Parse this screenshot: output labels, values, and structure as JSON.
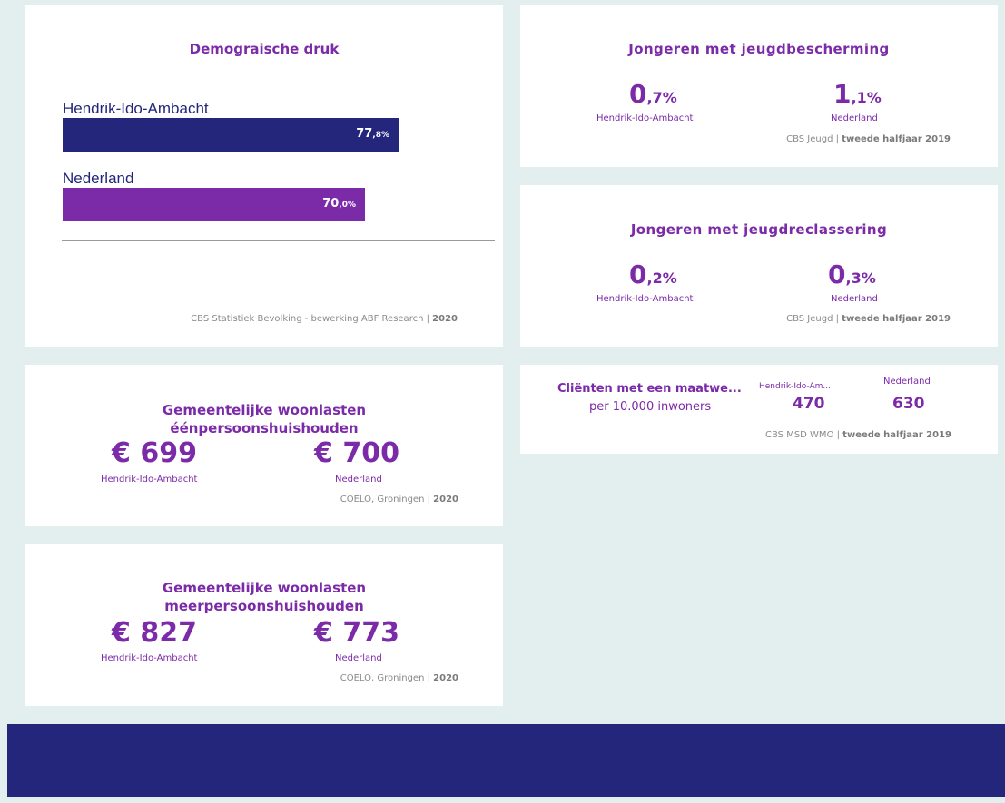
{
  "demografie": {
    "title": "Demograische druk",
    "source": "CBS Statistiek Bevolking - bewerking ABF Research",
    "source_year": "2020",
    "chart_data": {
      "type": "bar",
      "orientation": "horizontal",
      "categories": [
        "Hendrik-Ido-Ambacht",
        "Nederland"
      ],
      "values": [
        77.8,
        70.0
      ],
      "value_labels": [
        {
          "int": "77",
          "dec": ",8%"
        },
        {
          "int": "70",
          "dec": ",0%"
        }
      ],
      "colors": [
        "#23267a",
        "#7b2aa8"
      ],
      "xlim": [
        0,
        100
      ],
      "grid": false
    }
  },
  "jeugdbescherming": {
    "title": "Jongeren met jeugdbescherming",
    "a_int": "0",
    "a_dec": ",7%",
    "a_label": "Hendrik-Ido-Ambacht",
    "b_int": "1",
    "b_dec": ",1%",
    "b_label": "Nederland",
    "source": "CBS Jeugd",
    "source_period": "tweede halfjaar 2019"
  },
  "jeugdreclassering": {
    "title": "Jongeren met jeugdreclassering",
    "a_int": "0",
    "a_dec": ",2%",
    "a_label": "Hendrik-Ido-Ambacht",
    "b_int": "0",
    "b_dec": ",3%",
    "b_label": "Nederland",
    "source": "CBS Jeugd",
    "source_period": "tweede halfjaar 2019"
  },
  "maatwerk": {
    "title": "Cliënten met een maatwe...",
    "subtitle": "per 10.000 inwoners",
    "a_label": "Hendrik-Ido-Am...",
    "a_value": "470",
    "b_label": "Nederland",
    "b_value": "630",
    "source": "CBS MSD WMO",
    "source_period": "tweede halfjaar 2019"
  },
  "woonlasten_een": {
    "title_line1": "Gemeentelijke woonlasten",
    "title_line2": "éénpersoonshuishouden",
    "a_value": "€ 699",
    "a_label": "Hendrik-Ido-Ambacht",
    "b_value": "€ 700",
    "b_label": "Nederland",
    "source": "COELO, Groningen",
    "source_year": "2020"
  },
  "woonlasten_meer": {
    "title_line1": "Gemeentelijke woonlasten",
    "title_line2": "meerpersoonshuishouden",
    "a_value": "€ 827",
    "a_label": "Hendrik-Ido-Ambacht",
    "b_value": "€ 773",
    "b_label": "Nederland",
    "source": "COELO, Groningen",
    "source_year": "2020"
  }
}
